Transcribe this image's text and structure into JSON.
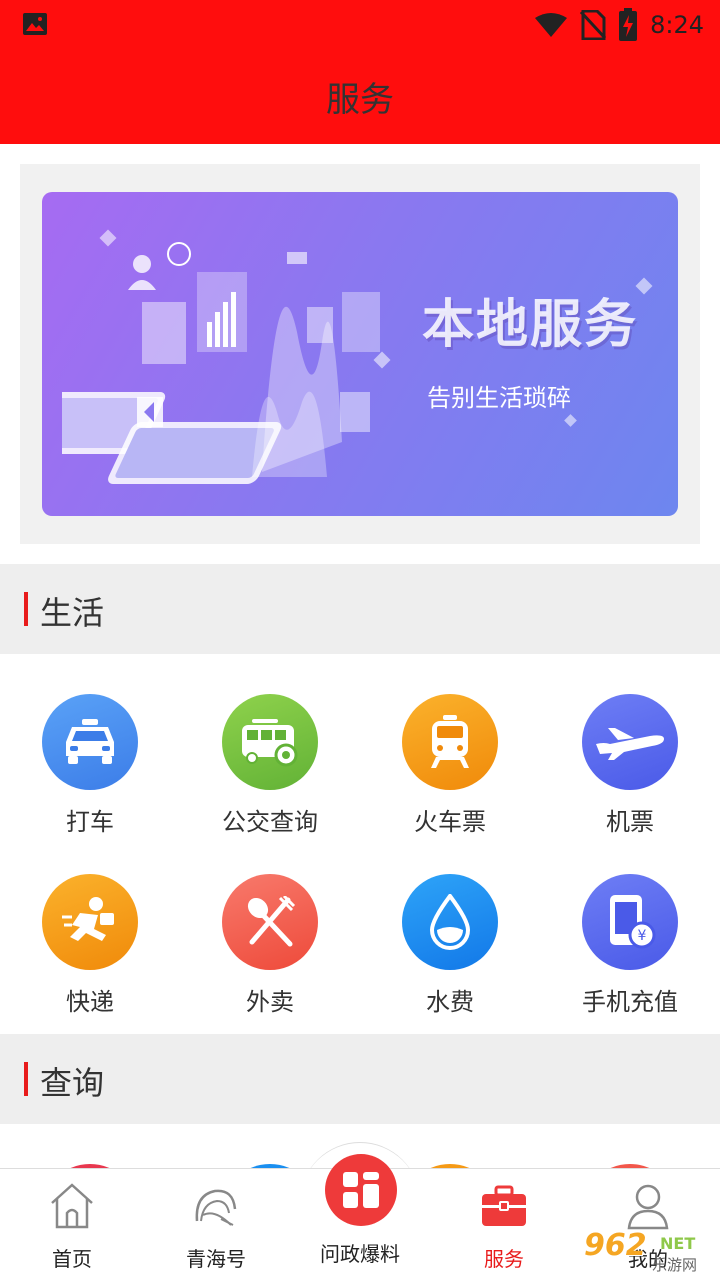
{
  "status_bar": {
    "time": "8:24"
  },
  "header": {
    "title": "服务"
  },
  "banner": {
    "title": "本地服务",
    "subtitle": "告别生活琐碎"
  },
  "sections": [
    {
      "title": "生活",
      "items": [
        {
          "label": "打车",
          "icon": "taxi-icon",
          "color": "#4a8ff0"
        },
        {
          "label": "公交查询",
          "icon": "bus-icon",
          "color": "#7cc43f"
        },
        {
          "label": "火车票",
          "icon": "train-icon",
          "color": "#f59a16"
        },
        {
          "label": "机票",
          "icon": "airplane-icon",
          "color": "#5b6cf0"
        },
        {
          "label": "快递",
          "icon": "courier-icon",
          "color": "#f59a16"
        },
        {
          "label": "外卖",
          "icon": "fork-spoon-icon",
          "color": "#f2574b"
        },
        {
          "label": "水费",
          "icon": "water-drop-icon",
          "color": "#1a8ff0"
        },
        {
          "label": "手机充值",
          "icon": "phone-recharge-icon",
          "color": "#5b6cf0"
        }
      ]
    },
    {
      "title": "查询"
    }
  ],
  "bottom_nav": {
    "items": [
      {
        "label": "首页",
        "icon": "home-icon"
      },
      {
        "label": "青海号",
        "icon": "qinghai-logo-icon"
      },
      {
        "label": "问政爆料",
        "icon": "report-icon"
      },
      {
        "label": "服务",
        "icon": "briefcase-icon",
        "active": true
      },
      {
        "label": "我的",
        "icon": "user-icon"
      }
    ]
  },
  "watermark": {
    "number": "962",
    "net": "NET",
    "name": "乐游网"
  },
  "colors": {
    "header_bg": "#ff0d0d",
    "accent": "#e81b1b"
  }
}
